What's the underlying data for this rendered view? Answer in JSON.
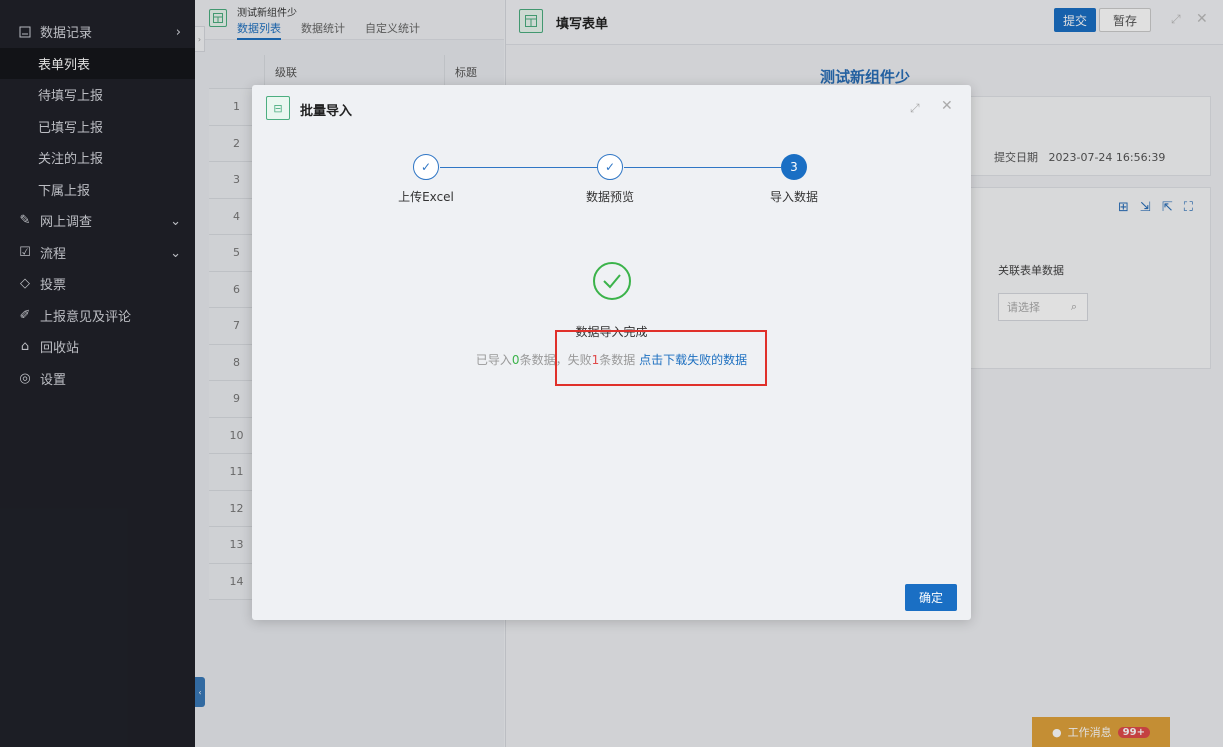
{
  "sidebar": {
    "items": [
      {
        "label": "数据记录",
        "icon": "document-icon",
        "expand": "chevron-right-icon"
      },
      {
        "label": "表单列表",
        "sub": true,
        "active": true
      },
      {
        "label": "待填写上报",
        "sub": true
      },
      {
        "label": "已填写上报",
        "sub": true
      },
      {
        "label": "关注的上报",
        "sub": true
      },
      {
        "label": "下属上报",
        "sub": true
      },
      {
        "label": "网上调查",
        "icon": "edit-icon",
        "expand": "chevron-down-icon"
      },
      {
        "label": "流程",
        "icon": "flow-icon",
        "expand": "chevron-down-icon"
      },
      {
        "label": "投票",
        "icon": "vote-icon"
      },
      {
        "label": "上报意见及评论",
        "icon": "comment-icon"
      },
      {
        "label": "回收站",
        "icon": "trash-icon"
      },
      {
        "label": "设置",
        "icon": "settings-icon"
      }
    ]
  },
  "left_panel": {
    "title": "测试新组件少",
    "tabs": [
      "数据列表",
      "数据统计",
      "自定义统计"
    ],
    "columns": [
      "级联",
      "标题"
    ],
    "rows": [
      "1",
      "2",
      "3",
      "4",
      "5",
      "6",
      "7",
      "8",
      "9",
      "10",
      "11",
      "12",
      "13",
      "14"
    ]
  },
  "right_panel": {
    "title": "填写表单",
    "submit": "提交",
    "save": "暂存",
    "form_title": "测试新组件少",
    "date_label": "提交日期",
    "date_value": "2023-07-24 16:56:39",
    "col_label": "关联表单数据",
    "select_placeholder": "请选择"
  },
  "dialog": {
    "title": "批量导入",
    "steps": [
      "上传Excel",
      "数据预览",
      "导入数据"
    ],
    "current_step": "3",
    "done_text": "数据导入完成",
    "stat_prefix": "已导入",
    "imported": "0",
    "stat_mid": "条数据，失败",
    "failed": "1",
    "stat_suffix": "条数据",
    "download_link": "点击下载失败的数据",
    "ok": "确定"
  },
  "notice": {
    "label": "工作消息",
    "badge": "99+"
  },
  "colors": {
    "primary": "#1a6fc4",
    "success": "#3bb34a",
    "danger": "#e04a4a",
    "highlight": "#e0302a"
  }
}
